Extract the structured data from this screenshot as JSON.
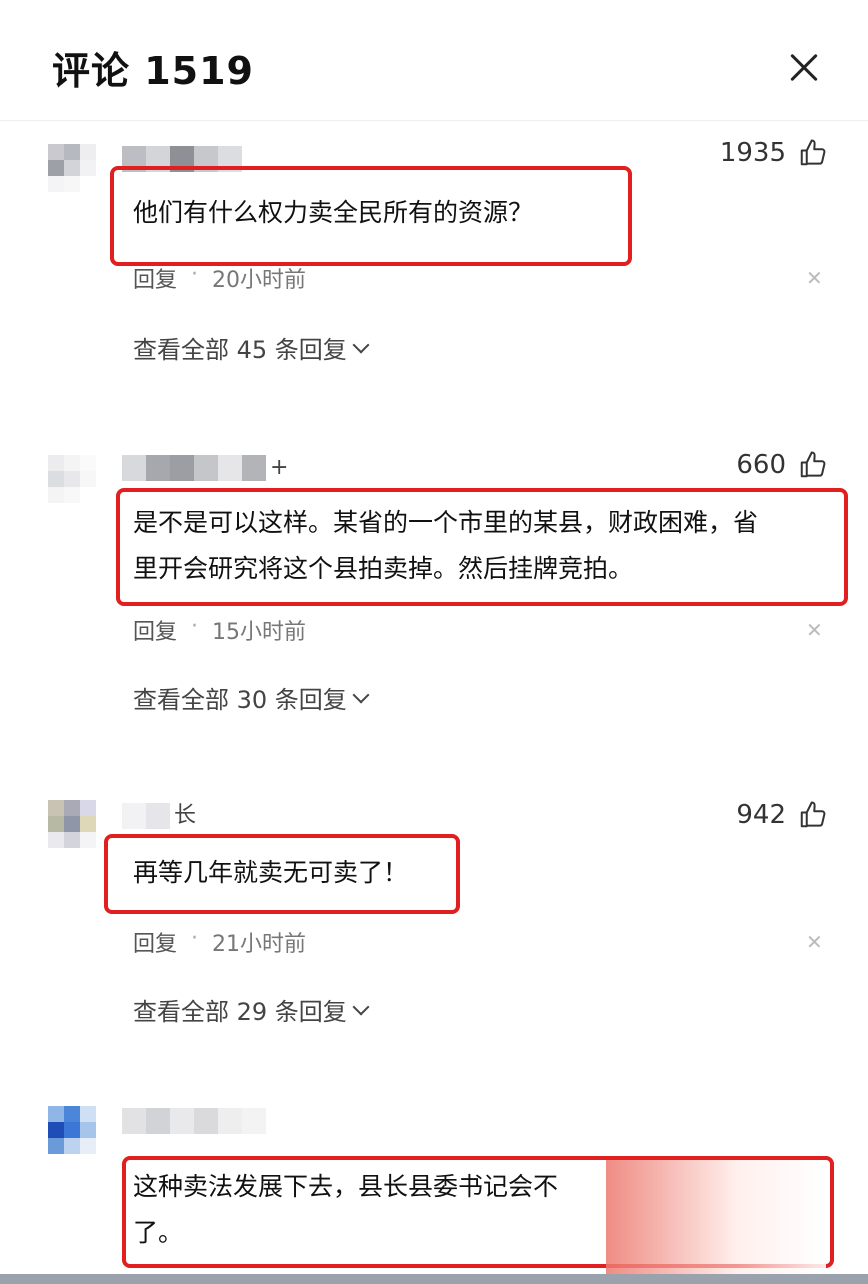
{
  "header": {
    "title": "评论 1519",
    "close_icon": "close-icon"
  },
  "comments": [
    {
      "avatar_colors": [
        "#c9c9cf",
        "#b7b9c1",
        "#eeeef1",
        "#9ea0a8",
        "#d3d4da",
        "#f2f2f4",
        "#f4f4f6",
        "#f7f7f8",
        "#ffffff"
      ],
      "name_colors": [
        "#bdbec3",
        "#d4d5d9",
        "#8f9095",
        "#c7c8cc",
        "#dcdde0"
      ],
      "name_tail": "",
      "likes": "1935",
      "text_lines": [
        "他们有什么权力卖全民所有的资源？"
      ],
      "reply_label": "回复",
      "time": "20小时前",
      "view_more": "查看全部 45 条回复"
    },
    {
      "avatar_colors": [
        "#ececee",
        "#f4f4f5",
        "#fafafa",
        "#dcdde0",
        "#e8e8ea",
        "#f7f7f8",
        "#f4f4f5",
        "#f8f8f9",
        "#ffffff"
      ],
      "name_colors": [
        "#d8d9dc",
        "#a7a8ad",
        "#9d9ea3",
        "#c5c6ca",
        "#e6e6e8",
        "#b3b4b8"
      ],
      "name_tail": "+",
      "likes": "660",
      "text_lines": [
        "是不是可以这样。某省的一个市里的某县，财政困难，省",
        "里开会研究将这个县拍卖掉。然后挂牌竞拍。"
      ],
      "reply_label": "回复",
      "time": "15小时前",
      "view_more": "查看全部 30 条回复"
    },
    {
      "avatar_colors": [
        "#c9c3b4",
        "#a9aab6",
        "#d8d8e8",
        "#b7b9a5",
        "#8e96a8",
        "#dfd8b8",
        "#e9e9ee",
        "#d4d4dc",
        "#f4f4f6"
      ],
      "name_colors": [
        "#f2f2f4",
        "#e6e6ea"
      ],
      "name_tail": "长",
      "likes": "942",
      "text_lines": [
        "再等几年就卖无可卖了！"
      ],
      "reply_label": "回复",
      "time": "21小时前",
      "view_more": "查看全部 29 条回复"
    },
    {
      "avatar_colors": [
        "#8fb6e6",
        "#4c86d8",
        "#cfe0f4",
        "#1f4db8",
        "#3a77d6",
        "#a7c4ea",
        "#6b9ad8",
        "#bcd2ef",
        "#e8eef8"
      ],
      "name_colors": [
        "#e2e2e4",
        "#d2d3d6",
        "#e9e9eb",
        "#dadadd",
        "#eeeeef",
        "#f3f3f4"
      ],
      "name_tail": "",
      "likes": "",
      "text_lines": [
        "这种卖法发展下去，县长县委书记会不",
        "了。"
      ],
      "reply_label": "",
      "time": "",
      "view_more": ""
    }
  ],
  "icons": {
    "like": "thumbs-up-icon",
    "dismiss": "dismiss-x-icon",
    "expand": "chevron-down-icon"
  }
}
